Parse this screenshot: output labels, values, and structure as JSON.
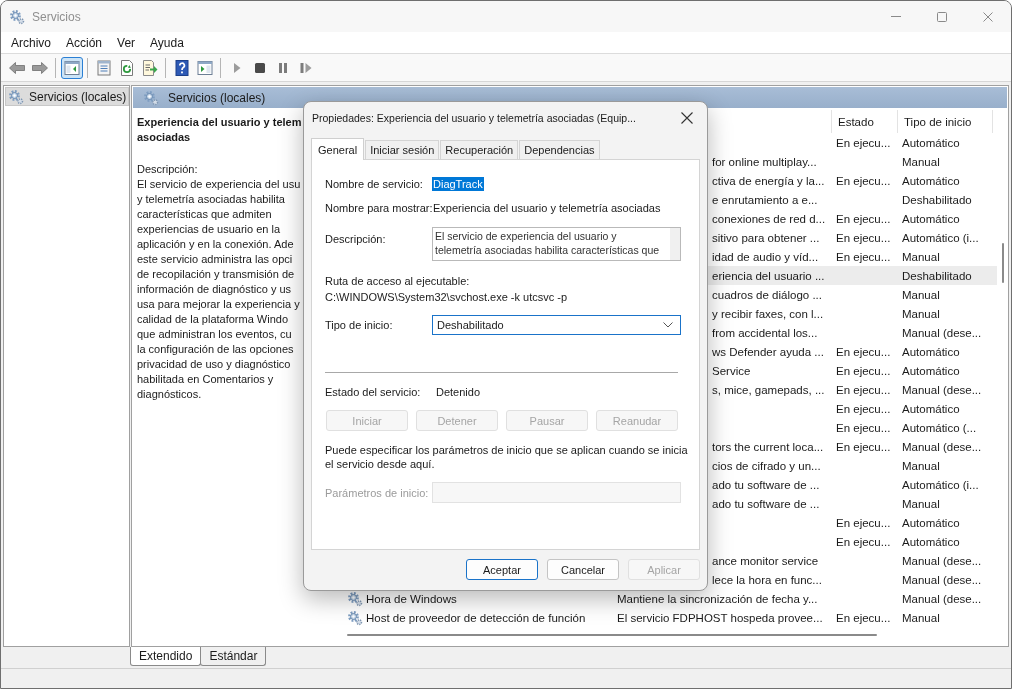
{
  "window": {
    "title": "Servicios"
  },
  "menu": [
    {
      "label": "Archivo"
    },
    {
      "label": "Acción"
    },
    {
      "label": "Ver"
    },
    {
      "label": "Ayuda"
    }
  ],
  "toolbar_groups": [
    {
      "buttons": [
        {
          "pressed": false
        },
        {
          "pressed": false
        }
      ]
    },
    {
      "buttons": [
        {
          "pressed": true
        }
      ]
    },
    {
      "buttons": [
        {
          "pressed": false
        },
        {
          "pressed": false
        },
        {
          "pressed": false
        }
      ]
    },
    {
      "buttons": [
        {
          "pressed": false
        },
        {
          "pressed": false
        }
      ]
    },
    {
      "buttons": [
        {
          "pressed": false
        },
        {
          "pressed": false
        },
        {
          "pressed": false
        },
        {
          "pressed": false
        }
      ]
    }
  ],
  "tree": [
    {
      "label": "Servicios (locales)",
      "selected": true
    }
  ],
  "pane_header": {
    "title": "Servicios (locales)"
  },
  "details": {
    "title_lines": [
      "Experiencia del usuario y telem",
      "asociadas"
    ],
    "description_label": "Descripción:",
    "description_lines": [
      "El servicio de experiencia del usu",
      "y telemetría asociadas habilita",
      "características que admiten",
      "experiencias de usuario en la",
      "aplicación y en la conexión. Ade",
      "este servicio administra las opci",
      "de recopilación y transmisión de",
      "información de diagnóstico y us",
      "usa para mejorar la experiencia y",
      "calidad de la plataforma Windo",
      "que administran los eventos, cu",
      "la configuración de las opciones",
      "privacidad de uso y diagnóstico",
      "habilitada en Comentarios y",
      "diagnósticos."
    ]
  },
  "table": {
    "columns": [
      {
        "label": "Estado"
      },
      {
        "label": "Tipo de inicio"
      }
    ],
    "rows": [
      {
        "status": "En ejecu...",
        "startup_type": "Automático",
        "selected": false
      },
      {
        "column_2": "for online multiplay...",
        "startup_type": "Manual",
        "selected": false
      },
      {
        "column_2": "ctiva de energía y la...",
        "status": "En ejecu...",
        "startup_type": "Automático",
        "selected": false
      },
      {
        "column_2": "e enrutamiento a e...",
        "startup_type": "Deshabilitado",
        "selected": false
      },
      {
        "column_2": "conexiones de red d...",
        "status": "En ejecu...",
        "startup_type": "Automático",
        "selected": false
      },
      {
        "column_2": "sitivo para obtener ...",
        "status": "En ejecu...",
        "startup_type": "Automático (i...",
        "selected": false
      },
      {
        "column_2": "idad de audio y víd...",
        "status": "En ejecu...",
        "startup_type": "Manual",
        "selected": false
      },
      {
        "column_2": "eriencia del usuario ...",
        "startup_type": "Deshabilitado",
        "selected": true
      },
      {
        "column_2": "cuadros de diálogo ...",
        "startup_type": "Manual",
        "selected": false
      },
      {
        "column_2": "y recibir faxes, con l...",
        "startup_type": "Manual",
        "selected": false
      },
      {
        "column_2": "from accidental los...",
        "startup_type": "Manual (dese...",
        "selected": false
      },
      {
        "column_2": "ws Defender ayuda ...",
        "status": "En ejecu...",
        "startup_type": "Automático",
        "selected": false
      },
      {
        "column_2": "Service",
        "status": "En ejecu...",
        "startup_type": "Automático",
        "selected": false
      },
      {
        "column_2": "s, mice, gamepads, ...",
        "status": "En ejecu...",
        "startup_type": "Manual (dese...",
        "selected": false
      },
      {
        "status": "En ejecu...",
        "startup_type": "Automático",
        "selected": false
      },
      {
        "status": "En ejecu...",
        "startup_type": "Automático (...",
        "selected": false
      },
      {
        "column_2": "tors the current loca...",
        "status": "En ejecu...",
        "startup_type": "Manual (dese...",
        "selected": false
      },
      {
        "column_2": "cios de cifrado y un...",
        "startup_type": "Manual",
        "selected": false
      },
      {
        "column_2": "ado tu software de ...",
        "startup_type": "Automático (i...",
        "selected": false
      },
      {
        "column_2": "ado tu software de ...",
        "startup_type": "Manual",
        "selected": false
      },
      {
        "status": "En ejecu...",
        "startup_type": "Automático",
        "selected": false
      },
      {
        "status": "En ejecu...",
        "startup_type": "Automático",
        "selected": false
      },
      {
        "column_2": "ance monitor service",
        "startup_type": "Manual (dese...",
        "selected": false
      },
      {
        "column_2": "lece la hora en func...",
        "startup_type": "Manual (dese...",
        "selected": false
      },
      {
        "column_1": "Hora de Windows",
        "column_2": "Mantiene la sincronización de fecha y...",
        "startup_type": "Manual (dese...",
        "selected": false
      },
      {
        "column_1": "Host de proveedor de detección de función",
        "column_2": "El servicio FDPHOST hospeda provee...",
        "status": "En ejecu...",
        "startup_type": "Manual",
        "selected": false
      }
    ]
  },
  "view_tabs": [
    {
      "label": "Extendido",
      "selected": true
    },
    {
      "label": "Estándar",
      "selected": false
    }
  ],
  "dialog": {
    "title": "Propiedades: Experiencia del usuario y telemetría asociadas (Equip...",
    "tabs": [
      {
        "label": "General",
        "selected": true
      },
      {
        "label": "Iniciar sesión",
        "selected": false
      },
      {
        "label": "Recuperación",
        "selected": false
      },
      {
        "label": "Dependencias",
        "selected": false
      }
    ],
    "service_name": {
      "label": "Nombre de servicio:",
      "value": "DiagTrack",
      "selected": true
    },
    "display_name": {
      "label": "Nombre para mostrar:",
      "value": "Experiencia del usuario y telemetría asociadas"
    },
    "description": {
      "label": "Descripción:",
      "lines": [
        "El servicio de experiencia del usuario y",
        "telemetría asociadas habilita características que"
      ]
    },
    "executable_path": {
      "label": "Ruta de acceso al ejecutable:",
      "value": "C:\\WINDOWS\\System32\\svchost.exe -k utcsvc -p"
    },
    "startup_type": {
      "label": "Tipo de inicio:",
      "value": "Deshabilitado",
      "focused": true
    },
    "service_status": {
      "label": "Estado del servicio:",
      "value": "Detenido"
    },
    "service_buttons": [
      {
        "label": "Iniciar",
        "disabled": true
      },
      {
        "label": "Detener",
        "disabled": true
      },
      {
        "label": "Pausar",
        "disabled": true
      },
      {
        "label": "Reanudar",
        "disabled": true
      }
    ],
    "hint": "Puede especificar los parámetros de inicio que se aplican cuando se inicia el servicio desde aquí.",
    "start_parameters": {
      "label": "Parámetros de inicio:",
      "disabled": true
    },
    "buttons": [
      {
        "label": "Aceptar",
        "default": true,
        "disabled": false
      },
      {
        "label": "Cancelar",
        "default": false,
        "disabled": false
      },
      {
        "label": "Aplicar",
        "default": false,
        "disabled": true
      }
    ]
  }
}
